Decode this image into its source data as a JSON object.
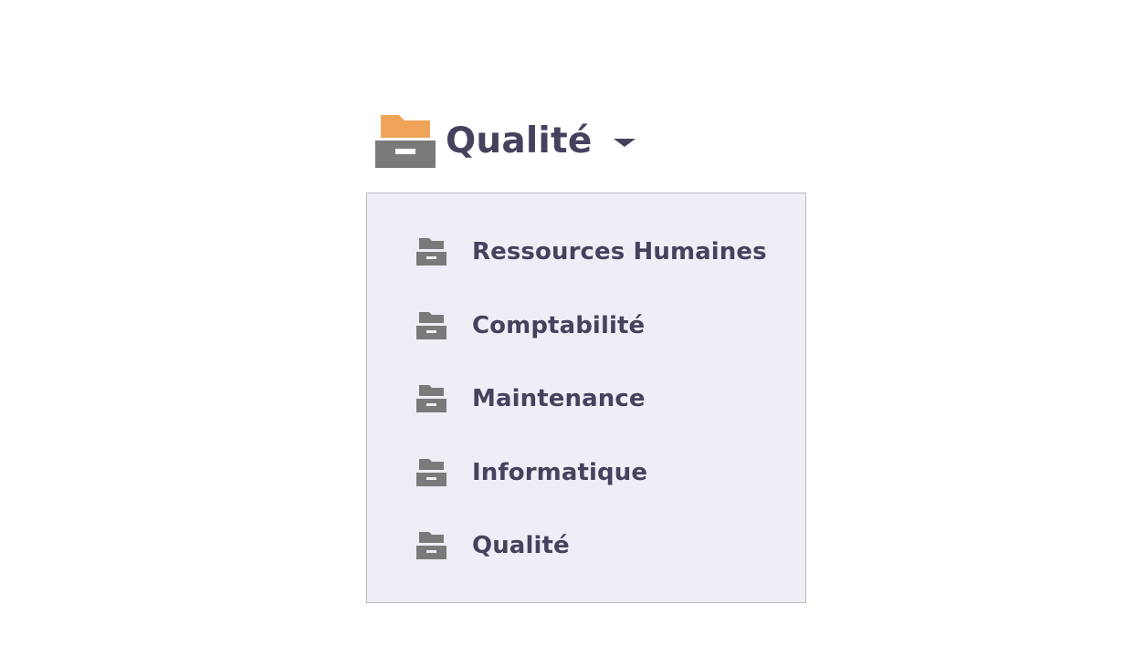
{
  "selector": {
    "label": "Qualité",
    "icon": "folder-archive-icon",
    "caret_icon": "caret-down-icon"
  },
  "dropdown": {
    "items": [
      {
        "label": "Ressources Humaines",
        "icon": "archive-icon"
      },
      {
        "label": "Comptabilité",
        "icon": "archive-icon"
      },
      {
        "label": "Maintenance",
        "icon": "archive-icon"
      },
      {
        "label": "Informatique",
        "icon": "archive-icon"
      },
      {
        "label": "Qualité",
        "icon": "archive-icon"
      }
    ]
  },
  "colors": {
    "text": "#46425e",
    "folder_orange": "#f0a45a",
    "icon_gray": "#7a7a7a",
    "menu_background": "#eeeef6",
    "menu_border": "#b9b9c2"
  }
}
